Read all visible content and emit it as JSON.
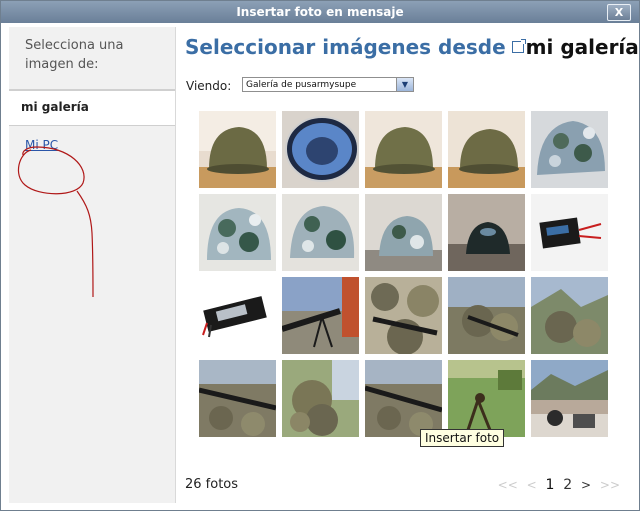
{
  "window": {
    "title": "Insertar foto en mensaje",
    "close_label": "X"
  },
  "sidebar": {
    "heading": "Selecciona una imagen de:",
    "active_item": "mi galería",
    "link_item": "Mi PC"
  },
  "main": {
    "title_prefix": "Seleccionar imágenes desde",
    "title_gallery": "mi galería",
    "viewing_label": "Viendo:",
    "gallery_select_value": "Galería de pusarmysupe",
    "photo_count": "26 fotos"
  },
  "tooltip": "Insertar foto",
  "pager": {
    "first": "<<",
    "prev": "<",
    "current": "1",
    "page2": "2",
    "next": ">",
    "last": ">>"
  },
  "thumbnails": [
    "helmet-olive-on-table",
    "helmet-interior-blue",
    "helmet-olive-on-table",
    "helmet-olive-on-table",
    "helmet-camo-painted",
    "helmet-camo-painted",
    "helmet-camo-painted",
    "helmet-camo-painted",
    "helmet-dark-on-rock",
    "battery-charger",
    "lipo-battery",
    "rifle-on-bipod",
    "rifle-ghillie",
    "ghillie-in-field",
    "ghillie-in-field",
    "rifle-ghillie",
    "ghillie-in-field",
    "rifle-ghillie",
    "field-bipod-grass",
    "town-view-gear"
  ],
  "colors": {
    "title_blue": "#3b6ea5",
    "link_blue": "#2a55a8",
    "titlebar": "#7a8fa8",
    "annotation_red": "#b01818"
  }
}
